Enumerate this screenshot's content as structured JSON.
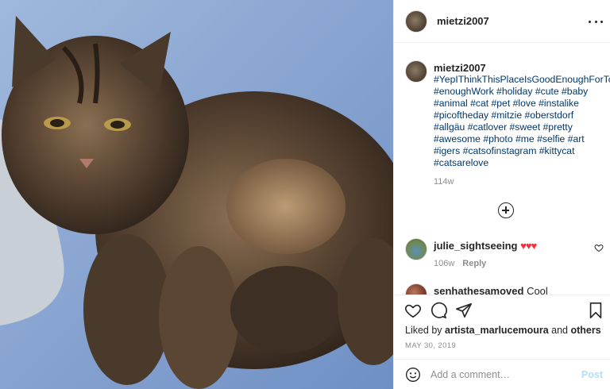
{
  "post": {
    "username": "mietzi2007",
    "caption": "#YepIThinkThisPlaceIsGoodEnoughForToday #enoughWork #holiday #cute #baby #animal #cat #pet #love #instalike #picoftheday #mitzie #oberstdorf #allgäu #catlover #sweet #pretty #awesome #photo #me #selfie #art #igers #catsofinstagram #kittycat #catsarelove",
    "caption_time": "114w",
    "photo_icon": "cat-photo"
  },
  "comments": [
    {
      "username": "julie_sightseeing",
      "text": "♥♥♥",
      "time": "106w",
      "reply": "Reply"
    },
    {
      "username": "senhathesamoved",
      "text": "Cool"
    }
  ],
  "actions": {
    "liked_prefix": "Liked by",
    "liked_user": "artista_marlucemoura",
    "liked_and": "and",
    "liked_others": "others",
    "date": "MAY 30, 2019"
  },
  "add_comment": {
    "placeholder": "Add a comment…",
    "post_label": "Post"
  },
  "colors": {
    "hashtag": "#00376b",
    "post_button_disabled": "#b2dffc",
    "hearts": "#ff2a3a"
  }
}
